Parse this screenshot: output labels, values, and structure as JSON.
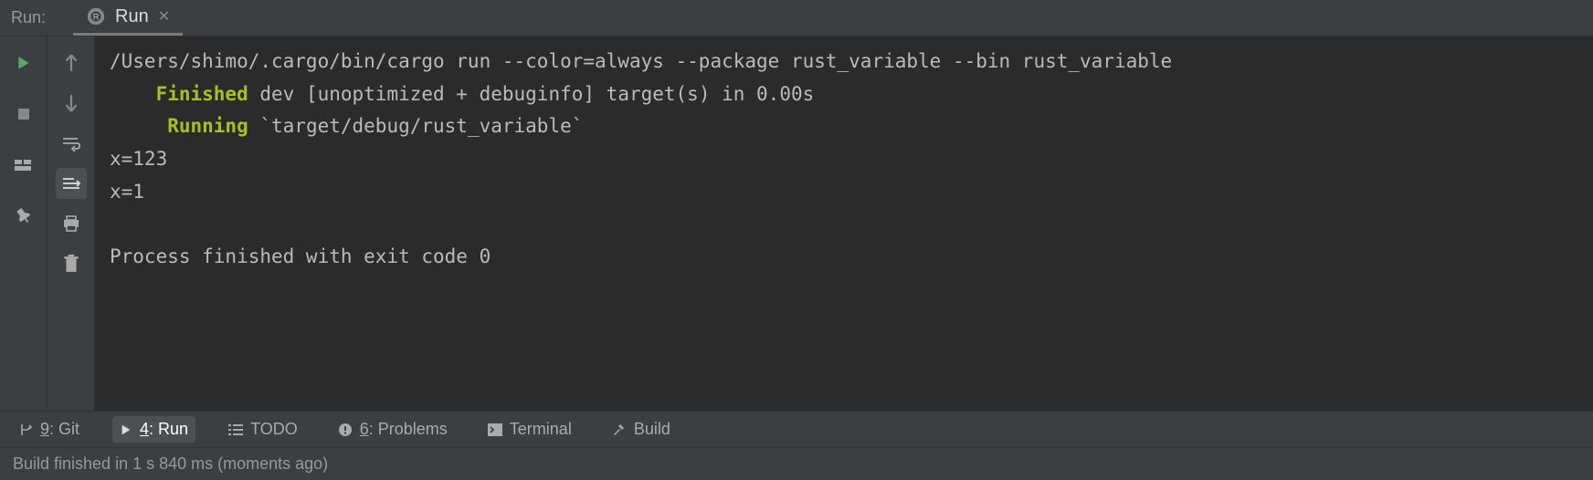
{
  "header": {
    "label": "Run:",
    "tab": {
      "title": "Run",
      "icon": "rust-icon"
    }
  },
  "console": {
    "cmd": "/Users/shimo/.cargo/bin/cargo run --color=always --package rust_variable --bin rust_variable",
    "finished_kw": "Finished",
    "finished_rest": " dev [unoptimized + debuginfo] target(s) in 0.00s",
    "running_kw": "Running",
    "running_rest": " `target/debug/rust_variable`",
    "out1": "x=123",
    "out2": "x=1",
    "exit": "Process finished with exit code 0"
  },
  "bottom": {
    "git": {
      "num": "9",
      "label": ": Git"
    },
    "run": {
      "num": "4",
      "label": ": Run"
    },
    "todo": "TODO",
    "problems": {
      "num": "6",
      "label": ": Problems"
    },
    "terminal": "Terminal",
    "build": "Build"
  },
  "status": "Build finished in 1 s 840 ms (moments ago)"
}
